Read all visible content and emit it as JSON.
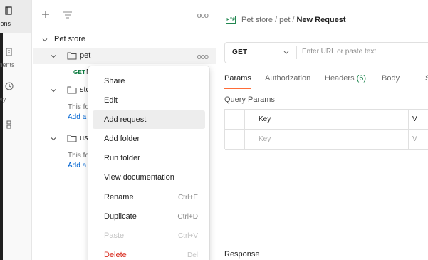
{
  "rail": {
    "items": [
      {
        "label": "tions",
        "icon": "collections-icon",
        "active": true
      },
      {
        "label": "ments",
        "icon": "environments-icon",
        "active": false
      },
      {
        "label": "ory",
        "icon": "history-icon",
        "active": false
      },
      {
        "label": "",
        "icon": "flows-icon",
        "active": false
      }
    ]
  },
  "sidebar": {
    "collection": "Pet store",
    "folders": [
      {
        "name": "pet"
      },
      {
        "name": "sto"
      },
      {
        "name": "use"
      }
    ],
    "request": {
      "method": "GET",
      "name": "N"
    },
    "empty_text": "This fo",
    "empty_link": "Add a",
    "more": "ooo"
  },
  "main": {
    "breadcrumb": {
      "parts": [
        "Pet store",
        "pet"
      ],
      "separator": "/",
      "current": "New Request"
    },
    "url_bar": {
      "method": "GET",
      "placeholder": "Enter URL or paste text"
    },
    "tabs": [
      {
        "label": "Params",
        "active": true
      },
      {
        "label": "Authorization",
        "active": false
      },
      {
        "label": "Headers",
        "count": "(6)",
        "active": false
      },
      {
        "label": "Body",
        "active": false
      },
      {
        "label": "S",
        "active": false
      }
    ],
    "query_params_title": "Query Params",
    "table": {
      "header": {
        "key": "Key",
        "value": "V"
      },
      "row_placeholder": {
        "key": "Key",
        "value": "V"
      }
    },
    "response_label": "Response"
  },
  "context_menu": {
    "items": [
      {
        "label": "Share",
        "shortcut": ""
      },
      {
        "label": "Edit",
        "shortcut": ""
      },
      {
        "label": "Add request",
        "shortcut": "",
        "hover": true
      },
      {
        "label": "Add folder",
        "shortcut": ""
      },
      {
        "label": "Run folder",
        "shortcut": ""
      },
      {
        "label": "View documentation",
        "shortcut": ""
      },
      {
        "label": "Rename",
        "shortcut": "Ctrl+E"
      },
      {
        "label": "Duplicate",
        "shortcut": "Ctrl+D"
      },
      {
        "label": "Paste",
        "shortcut": "Ctrl+V",
        "disabled": true
      },
      {
        "label": "Delete",
        "shortcut": "Del",
        "danger": true
      }
    ]
  },
  "colors": {
    "accent": "#ff6c37",
    "get_method": "#0a7a3e",
    "link": "#0265d2",
    "danger": "#d92d20"
  }
}
